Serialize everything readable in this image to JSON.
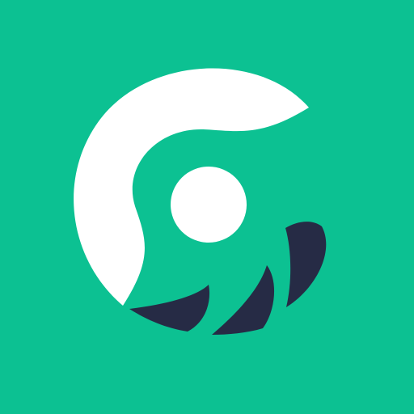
{
  "app_icon": {
    "icon_name": "swirl-logo-icon",
    "colors": {
      "background": "#0CC192",
      "swirl": "#FFFFFF",
      "center_dot": "#FFFFFF",
      "fins": "#262B45"
    }
  }
}
